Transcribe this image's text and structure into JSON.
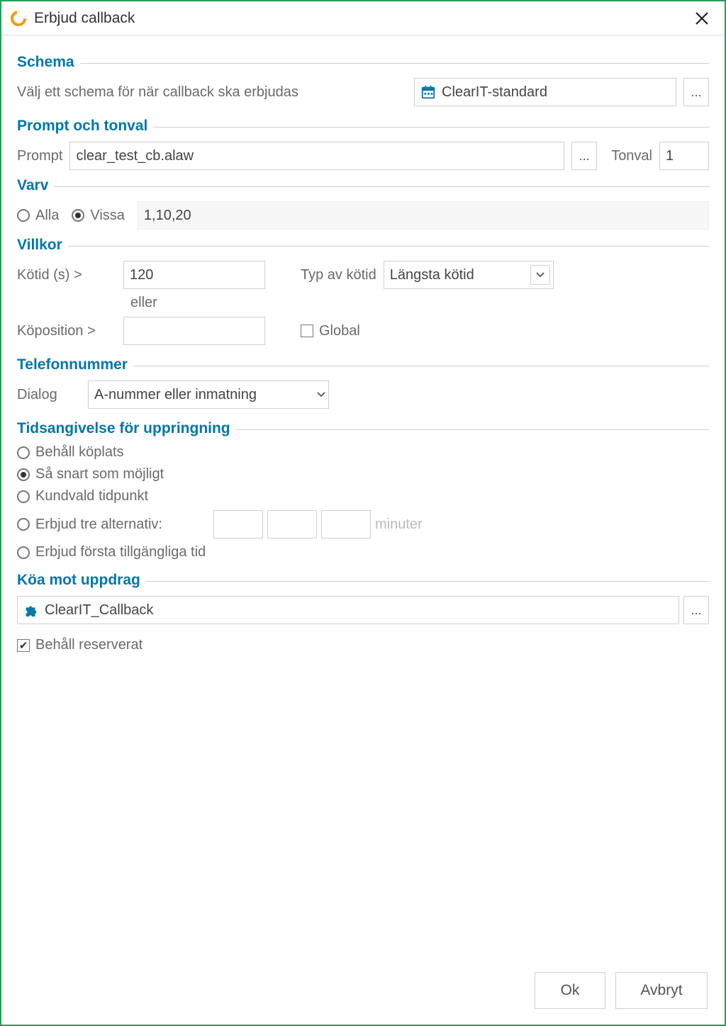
{
  "window": {
    "title": "Erbjud callback"
  },
  "schema": {
    "legend": "Schema",
    "label": "Välj ett schema för när callback ska erbjudas",
    "value": "ClearIT-standard"
  },
  "prompt": {
    "legend": "Prompt och tonval",
    "promptLabel": "Prompt",
    "promptValue": "clear_test_cb.alaw",
    "toneLabel": "Tonval",
    "toneValue": "1"
  },
  "varv": {
    "legend": "Varv",
    "optAll": "Alla",
    "optSome": "Vissa",
    "someValue": "1,10,20"
  },
  "villkor": {
    "legend": "Villkor",
    "kotidLabel": "Kötid (s) >",
    "kotidValue": "120",
    "typLabel": "Typ av kötid",
    "typValue": "Längsta kötid",
    "or": "eller",
    "kopositionLabel": "Köposition >",
    "kopositionValue": "",
    "globalLabel": "Global"
  },
  "telefon": {
    "legend": "Telefonnummer",
    "dialogLabel": "Dialog",
    "dialogValue": "A-nummer eller inmatning"
  },
  "tids": {
    "legend": "Tidsangivelse för uppringning",
    "opt1": "Behåll köplats",
    "opt2": "Så snart som möjligt",
    "opt3": "Kundvald tidpunkt",
    "opt4": "Erbjud tre alternativ:",
    "opt5": "Erbjud första tillgängliga tid",
    "minutesLabel": "minuter"
  },
  "koa": {
    "legend": "Köa mot uppdrag",
    "value": "ClearIT_Callback",
    "keepReserved": "Behåll reserverat"
  },
  "buttons": {
    "ok": "Ok",
    "cancel": "Avbryt"
  }
}
